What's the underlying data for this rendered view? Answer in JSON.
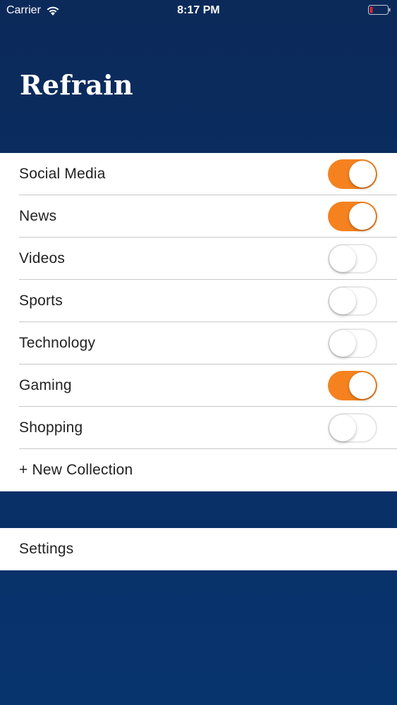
{
  "status_bar": {
    "carrier": "Carrier",
    "time": "8:17 PM",
    "icons": [
      "wifi-icon",
      "battery-icon"
    ]
  },
  "header": {
    "title": "Refrain"
  },
  "collections": [
    {
      "label": "Social Media",
      "enabled": true
    },
    {
      "label": "News",
      "enabled": true
    },
    {
      "label": "Videos",
      "enabled": false
    },
    {
      "label": "Sports",
      "enabled": false
    },
    {
      "label": "Technology",
      "enabled": false
    },
    {
      "label": "Gaming",
      "enabled": true
    },
    {
      "label": "Shopping",
      "enabled": false
    }
  ],
  "new_collection_label": "+ New Collection",
  "settings_label": "Settings",
  "colors": {
    "background": "#0b2a5a",
    "toggle_on": "#f5821f",
    "battery_low": "#e0242b"
  }
}
